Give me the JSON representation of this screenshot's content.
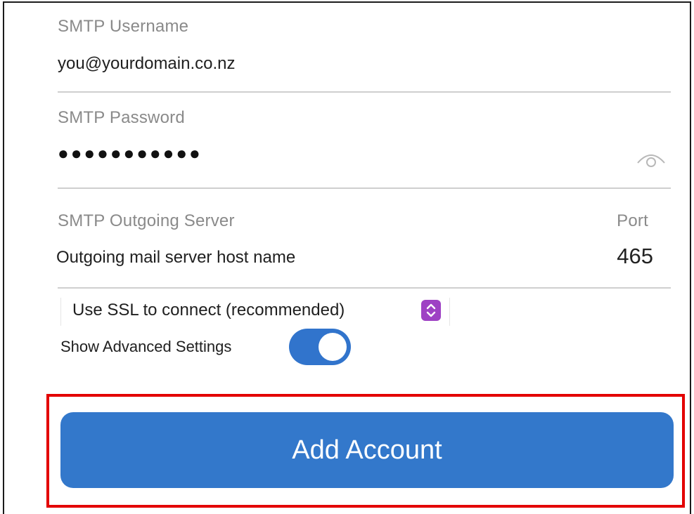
{
  "form": {
    "smtp_username": {
      "label": "SMTP Username",
      "value": "you@yourdomain.co.nz"
    },
    "smtp_password": {
      "label": "SMTP Password",
      "masked_value": "●●●●●●●●●●●",
      "reveal_icon": "eye-icon"
    },
    "smtp_server": {
      "label": "SMTP Outgoing Server",
      "value": "Outgoing mail server host name"
    },
    "port": {
      "label": "Port",
      "value": "465"
    },
    "ssl_select": {
      "selected": "Use SSL to connect (recommended)",
      "icon": "select-arrows-icon"
    },
    "advanced": {
      "label": "Show Advanced Settings",
      "enabled": true
    }
  },
  "actions": {
    "add_account_label": "Add Account"
  },
  "colors": {
    "accent": "#3378cb",
    "toggle_on": "#3174cc",
    "select_accent": "#9e41c4",
    "highlight": "#e30000",
    "label": "#8a8a8a",
    "divider": "#cfcfcf"
  }
}
